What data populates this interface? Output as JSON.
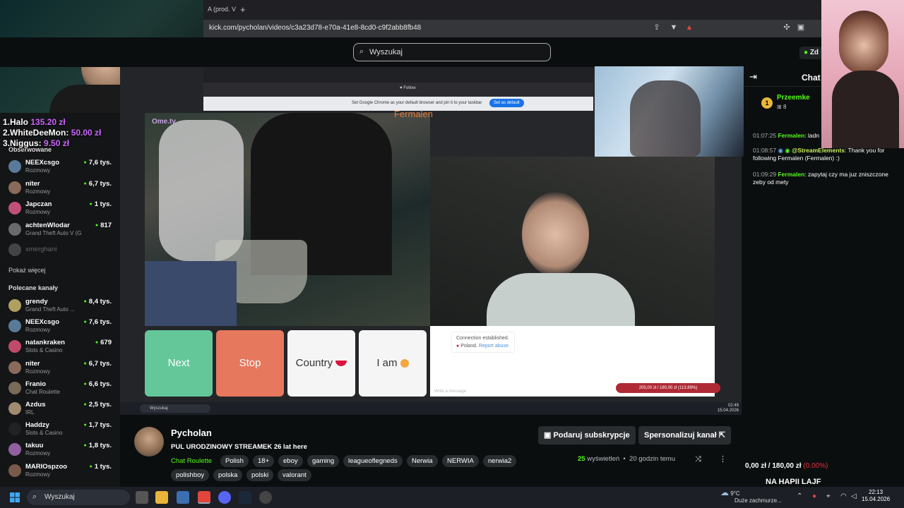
{
  "browser": {
    "tab_title": "A (prod. V",
    "new_tab": "+",
    "url": "kick.com/pycholan/videos/c3a23d78-e70a-41e8-8cd0-c9f2abb8fb48"
  },
  "search": {
    "placeholder": "Wyszukaj"
  },
  "leaderboard": [
    {
      "rank": "1.Halo",
      "name": "",
      "amount": "135.20 zł"
    },
    {
      "rank": "2.WhiteDeeMon:",
      "name": "",
      "amount": "50.00 zł"
    },
    {
      "rank": "3.Niggus:",
      "name": "",
      "amount": "9.50 zł"
    }
  ],
  "sidebar": {
    "section_followed": "Obserwowane",
    "followed": [
      {
        "name": "NEEXcsgo",
        "category": "Rozmowy",
        "viewers": "7,6 tys.",
        "color": "#5a7a9a"
      },
      {
        "name": "niter",
        "category": "Rozmowy",
        "viewers": "6,7 tys.",
        "color": "#8a6a5a"
      },
      {
        "name": "Japczan",
        "category": "Rozmowy",
        "viewers": "1 tys.",
        "color": "#c0507a"
      },
      {
        "name": "achtenWlodar",
        "category": "Grand Theft Auto V (G...",
        "viewers": "817",
        "color": "#6a6a6a"
      },
      {
        "name": "xmerghani",
        "category": "",
        "viewers": "",
        "color": "#444"
      }
    ],
    "show_more": "Pokaż więcej",
    "section_recommended": "Polecane kanały",
    "recommended": [
      {
        "name": "grendy",
        "category": "Grand Theft Auto ...",
        "viewers": "8,4 tys.",
        "color": "#b0a060"
      },
      {
        "name": "NEEXcsgo",
        "category": "Rozmowy",
        "viewers": "7,6 tys.",
        "color": "#5a7a9a"
      },
      {
        "name": "natankraken",
        "category": "Slots & Casino",
        "viewers": "679",
        "color": "#c04a6a"
      },
      {
        "name": "niter",
        "category": "Rozmowy",
        "viewers": "6,7 tys.",
        "color": "#8a6a5a"
      },
      {
        "name": "Franio",
        "category": "Chat Roulette",
        "viewers": "6,6 tys.",
        "color": "#7a6a5a"
      },
      {
        "name": "Azdus",
        "category": "IRL",
        "viewers": "2,5 tys.",
        "color": "#a08a70"
      },
      {
        "name": "Haddzy",
        "category": "Slots & Casino",
        "viewers": "1,7 tys.",
        "color": "#222"
      },
      {
        "name": "takuu",
        "category": "Rozmowy",
        "viewers": "1,8 tys.",
        "color": "#9060a0"
      },
      {
        "name": "MARIOspzoo",
        "category": "Rozmowy",
        "viewers": "1 tys.",
        "color": "#7a5a4a"
      }
    ]
  },
  "video": {
    "inner_follow": "Follow",
    "default_bar": "Set Google Chrome as your default browser and pin it to your taskbar",
    "default_btn": "Set as default",
    "overlay_name": "Fermalen",
    "ome_logo": "Ome.tv",
    "buttons": {
      "next": "Next",
      "stop": "Stop",
      "country": "Country",
      "iam": "I am"
    },
    "chat_conn": "Connection established.",
    "chat_country": "Poland.",
    "chat_report": "Report abuse.",
    "chat_write": "Write a message",
    "progress": "205,00 zł / 180,00 zł (113.89%)",
    "inner_search": "Wyszukaj",
    "inner_clock_time": "02:49",
    "inner_clock_date": "15.04.2026"
  },
  "stream": {
    "channel": "Pycholan",
    "title": "PUL URODZINOWY STREAMEK 26 lat here",
    "category": "Chat Roulette",
    "tags": [
      "Polish",
      "18+",
      "eboy",
      "gaming",
      "leagueoflegneds",
      "Nerwia",
      "NERWIA",
      "nerwia2",
      "polishboy",
      "polska",
      "polski",
      "valorant"
    ],
    "subscribe_btn": "Podaruj subskrypcje",
    "customize_btn": "Spersonalizuj kanał",
    "views_count": "25",
    "views_label": "wyświetleń",
    "time_ago": "20 godzin temu"
  },
  "chat": {
    "title": "Chat",
    "pinned_user": "Przeemke",
    "pinned_badge": "1",
    "pinned_count": "8",
    "messages": [
      {
        "ts": "01:07:25",
        "user": "Fermalen",
        "text": ": ladn"
      },
      {
        "ts": "01:08:57",
        "user": "@StreamElements",
        "text": ": Thank you for following Fermalen (Fermalen) :)"
      },
      {
        "ts": "01:09:29",
        "user": "Fermalen",
        "text": ": zapytaj czy ma juz zniszczone zeby od mety"
      }
    ],
    "goal_current": "0,00 zł",
    "goal_sep": " / ",
    "goal_target": "180,00 zł",
    "goal_pct": "(0.00%)",
    "goal_name": "NA HAPII LAJF",
    "top_badge": "Zd"
  },
  "taskbar": {
    "search": "Wyszukaj",
    "temp": "9°C",
    "weather": "Duże zachmurze...",
    "time": "22:13",
    "date": "15.04.2026"
  },
  "colors": {
    "kick_green": "#53fc18",
    "next": "#64c79a",
    "stop": "#e6785e"
  }
}
